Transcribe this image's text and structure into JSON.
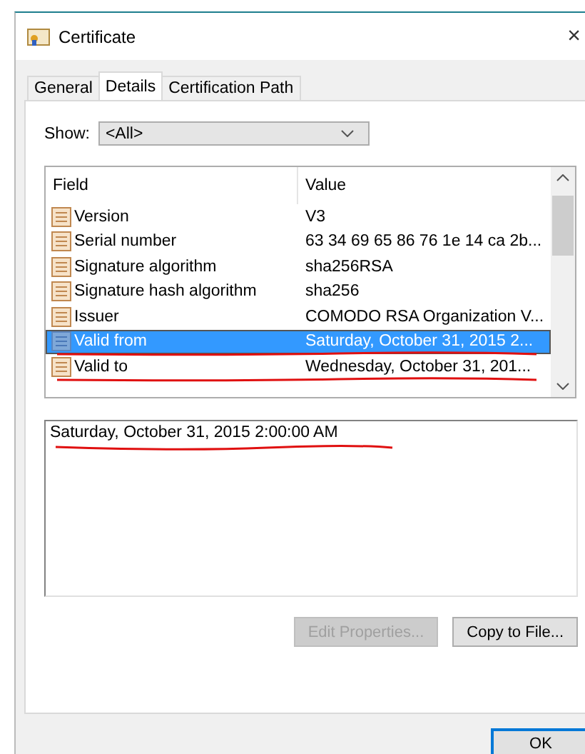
{
  "window": {
    "title": "Certificate",
    "close": "×"
  },
  "tabs": [
    {
      "label": "General",
      "selected": false
    },
    {
      "label": "Details",
      "selected": true
    },
    {
      "label": "Certification Path",
      "selected": false
    }
  ],
  "show": {
    "label": "Show:",
    "value": "<All>"
  },
  "list": {
    "columns": [
      "Field",
      "Value"
    ],
    "rows": [
      {
        "field": "Version",
        "value": "V3",
        "selected": false,
        "underlined": false
      },
      {
        "field": "Serial number",
        "value": "63 34 69 65 86 76 1e 14 ca 2b...",
        "selected": false,
        "underlined": false
      },
      {
        "field": "Signature algorithm",
        "value": "sha256RSA",
        "selected": false,
        "underlined": false
      },
      {
        "field": "Signature hash algorithm",
        "value": "sha256",
        "selected": false,
        "underlined": false
      },
      {
        "field": "Issuer",
        "value": "COMODO RSA Organization V...",
        "selected": false,
        "underlined": false
      },
      {
        "field": "Valid from",
        "value": "Saturday, October 31, 2015 2...",
        "selected": true,
        "underlined": true
      },
      {
        "field": "Valid to",
        "value": "Wednesday, October 31, 201...",
        "selected": false,
        "underlined": true
      }
    ]
  },
  "detail": {
    "text": "Saturday, October 31, 2015 2:00:00 AM",
    "underlined": true
  },
  "buttons": [
    {
      "label": "Edit Properties...",
      "disabled": true
    },
    {
      "label": "Copy to File...",
      "disabled": false
    }
  ],
  "footer_buttons": [
    {
      "label": "OK",
      "disabled": false
    }
  ]
}
